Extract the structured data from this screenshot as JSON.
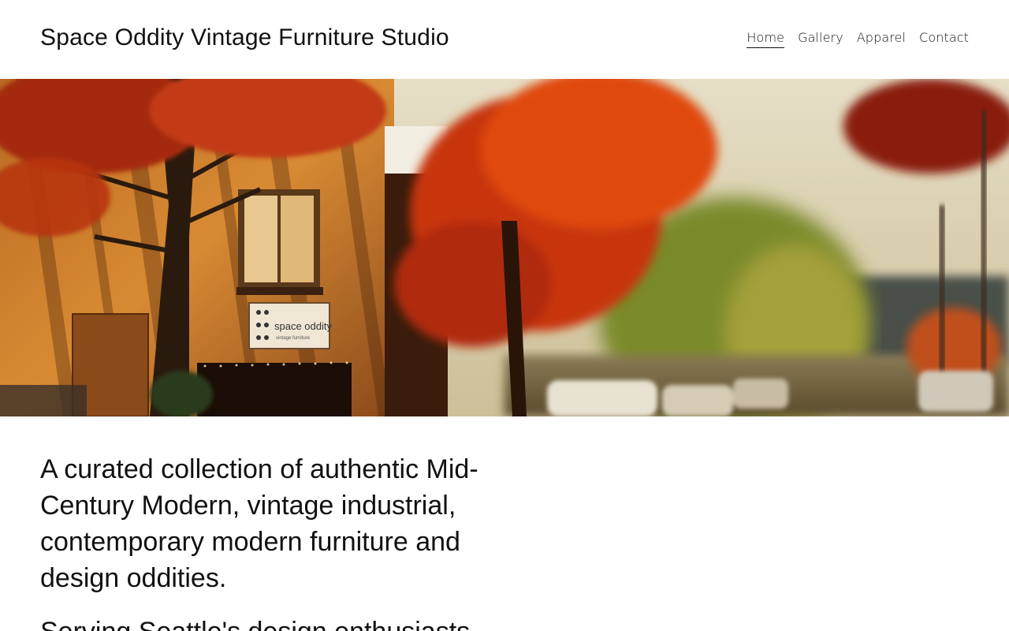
{
  "header": {
    "site_title": "Space Oddity Vintage Furniture Studio",
    "nav": [
      {
        "label": "Home",
        "active": true
      },
      {
        "label": "Gallery",
        "active": false
      },
      {
        "label": "Apparel",
        "active": false
      },
      {
        "label": "Contact",
        "active": false
      }
    ]
  },
  "hero": {
    "image_description": "autumn-street-storefront-photo",
    "sign_text": "space oddity",
    "sign_subtext": "vintage furniture"
  },
  "main": {
    "lead": "A curated collection of authentic Mid-Century Modern, vintage industrial, contemporary modern furniture and design oddities.",
    "lead2_partial": "Serving Seattle's design enthusiasts"
  },
  "colors": {
    "text": "#111111",
    "background": "#ffffff"
  }
}
